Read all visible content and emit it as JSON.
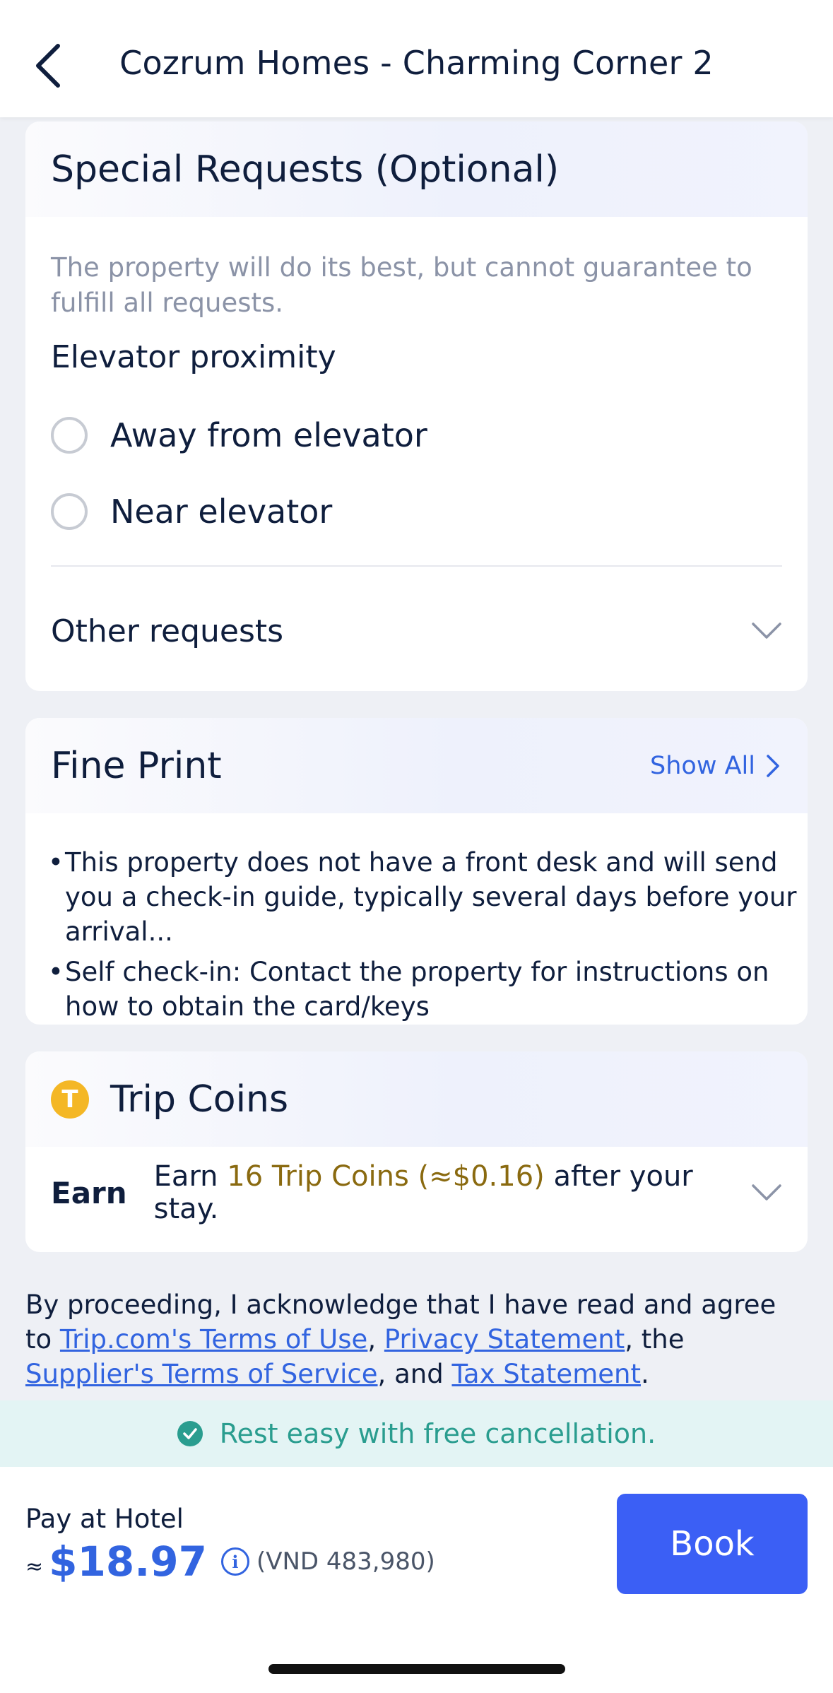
{
  "header": {
    "title": "Cozrum Homes - Charming Corner 2"
  },
  "special_requests": {
    "title": "Special Requests (Optional)",
    "note": "The property will do its best, but cannot guarantee to fulfill all requests.",
    "elevator_title": "Elevator proximity",
    "options": [
      {
        "label": "Away from elevator",
        "selected": false
      },
      {
        "label": "Near elevator",
        "selected": false
      }
    ],
    "other_requests": "Other requests"
  },
  "fine_print": {
    "title": "Fine Print",
    "show_all": "Show All",
    "bullets": [
      "This property does not have a front desk and will send you a check-in guide, typically several days before your arrival...",
      "Self check-in: Contact the property for instructions on how to obtain the card/keys"
    ]
  },
  "trip_coins": {
    "title": "Trip Coins",
    "earn_label": "Earn",
    "earn_prefix": "Earn ",
    "earn_amount": "16 Trip Coins (≈$0.16)",
    "earn_suffix": " after your stay."
  },
  "legal": {
    "intro": "By proceeding, I acknowledge that I have read and agree to ",
    "terms_link": "Trip.com's Terms of Use",
    "sep1": ", ",
    "privacy_link": "Privacy Statement",
    "sep2": ", the ",
    "supplier_link": "Supplier's Terms of Service",
    "sep3": ", and ",
    "tax_link": "Tax Statement",
    "end": "."
  },
  "cancellation": {
    "text": "Rest easy with free cancellation."
  },
  "footer": {
    "pay_label": "Pay at Hotel",
    "approx_symbol": "≈",
    "price": "$18.97",
    "local_price": "(VND 483,980)",
    "book_label": "Book"
  },
  "colors": {
    "accent": "#3b5ff5",
    "link": "#3264e0",
    "coin": "#f4b725",
    "success": "#2a9d8f"
  }
}
